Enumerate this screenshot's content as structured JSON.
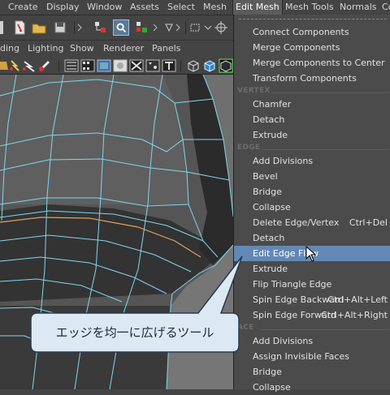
{
  "menubar": {
    "items": [
      "Create",
      "Display",
      "Window",
      "Assets",
      "Select",
      "Mesh",
      "Edit Mesh",
      "Mesh Tools",
      "Normals",
      "Co"
    ]
  },
  "panel_menu": {
    "items": [
      "ding",
      "Lighting",
      "Show",
      "Renderer",
      "Panels"
    ]
  },
  "dropdown": {
    "top_items": [
      "Connect Components",
      "Merge Components",
      "Merge Components to Center",
      "Transform Components"
    ],
    "vertex_header": "VERTEX",
    "vertex_items": [
      "Chamfer",
      "Detach",
      "Extrude"
    ],
    "edge_header": "EDGE",
    "edge_items": [
      {
        "label": "Add Divisions",
        "shortcut": ""
      },
      {
        "label": "Bevel",
        "shortcut": ""
      },
      {
        "label": "Bridge",
        "shortcut": ""
      },
      {
        "label": "Collapse",
        "shortcut": ""
      },
      {
        "label": "Delete Edge/Vertex",
        "shortcut": "Ctrl+Del"
      },
      {
        "label": "Detach",
        "shortcut": ""
      },
      {
        "label": "Edit Edge Flow",
        "shortcut": "",
        "highlighted": true
      },
      {
        "label": "Extrude",
        "shortcut": ""
      },
      {
        "label": "Flip Triangle Edge",
        "shortcut": ""
      },
      {
        "label": "Spin Edge Backward",
        "shortcut": "Ctrl+Alt+Left"
      },
      {
        "label": "Spin Edge Forward",
        "shortcut": "Ctrl+Alt+Right"
      }
    ],
    "face_header": "ACE",
    "face_items": [
      "Add Divisions",
      "Assign Invisible Faces",
      "Bridge",
      "Collapse"
    ]
  },
  "callout": {
    "text": "エッジを均一に広げるツール"
  },
  "colors": {
    "highlight": "#6388b5",
    "wire": "#7fd7f0",
    "selected_edge": "#e0a060",
    "callout_fill": "#dce8f4"
  }
}
